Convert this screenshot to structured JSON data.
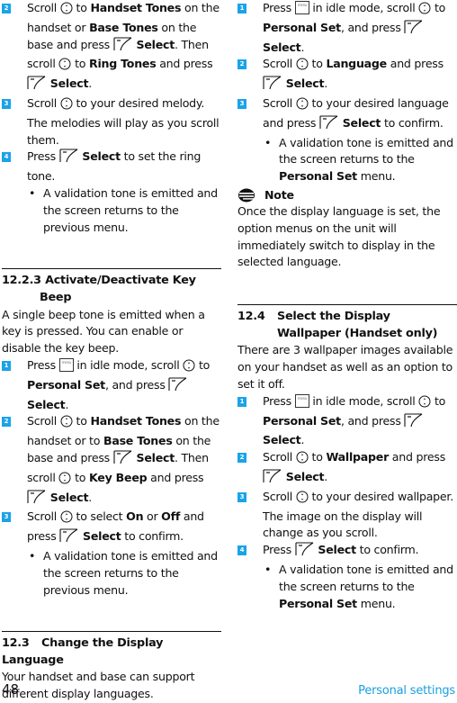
{
  "page": {
    "number": "48",
    "section_title": "Personal settings",
    "accent_color": "#1aa3e8",
    "footer_color": "#1a9fe0"
  },
  "left": {
    "top_steps": [
      {
        "n": "2",
        "parts": [
          "Scroll ",
          "{scroll}",
          " to ",
          "**Handset Tones**",
          " on the handset or ",
          "**Base Tones**",
          " on the base and press ",
          "{select}",
          " ",
          "**Select**",
          ". Then scroll ",
          "{scroll}",
          " to ",
          "**Ring Tones**",
          " and press ",
          "{select}",
          " ",
          "**Select**",
          "."
        ]
      },
      {
        "n": "3",
        "parts": [
          "Scroll ",
          "{scroll}",
          " to your desired melody. The melodies will play as you scroll them."
        ]
      },
      {
        "n": "4",
        "parts": [
          "Press ",
          "{select}",
          " ",
          "**Select**",
          " to set the ring tone."
        ]
      }
    ],
    "top_bullet": "A validation tone is emitted and the screen returns to the previous menu.",
    "key_beep": {
      "number": "12.2.3",
      "title": "Activate/Deactivate Key Beep",
      "intro": "A single beep tone is emitted when a key is pressed. You can enable or disable the key beep.",
      "steps": [
        {
          "n": "1",
          "parts": [
            "Press ",
            "{menu}",
            " in idle mode, scroll ",
            "{scroll}",
            " to ",
            "**Personal Set**",
            ", and press ",
            "{select}",
            " ",
            "**Select**",
            "."
          ]
        },
        {
          "n": "2",
          "parts": [
            "Scroll ",
            "{scroll}",
            " to ",
            "**Handset Tones**",
            " on the handset or to ",
            "**Base Tones**",
            " on the base and press ",
            "{select}",
            " ",
            "**Select**",
            ". Then scroll ",
            "{scroll}",
            " to ",
            "**Key Beep**",
            " and press ",
            "{select}",
            " ",
            "**Select**",
            "."
          ]
        },
        {
          "n": "3",
          "parts": [
            "Scroll ",
            "{scroll}",
            " to select ",
            "**On**",
            " or ",
            "**Off**",
            " and press ",
            "{select}",
            " ",
            "**Select**",
            " to confirm."
          ]
        }
      ],
      "bullet": "A validation tone is emitted and the screen returns to the previous menu."
    },
    "language": {
      "number": "12.3",
      "title": "Change the Display Language",
      "intro": "Your handset and base can support different display languages."
    }
  },
  "right": {
    "language_steps": [
      {
        "n": "1",
        "parts": [
          "Press ",
          "{menu}",
          " in idle mode, scroll ",
          "{scroll}",
          " to ",
          "**Personal Set**",
          ", and press ",
          "{select}",
          " ",
          "**Select**",
          "."
        ]
      },
      {
        "n": "2",
        "parts": [
          "Scroll ",
          "{scroll}",
          " to ",
          "**Language**",
          " and press ",
          "{select}",
          " ",
          "**Select**",
          "."
        ]
      },
      {
        "n": "3",
        "parts": [
          "Scroll ",
          "{scroll}",
          " to your desired language and press ",
          "{select}",
          " ",
          "**Select**",
          " to confirm."
        ]
      }
    ],
    "language_bullet": [
      "A validation tone is emitted and the screen returns to the ",
      "**Personal Set**",
      " menu."
    ],
    "note": {
      "label": "Note",
      "text": "Once the display language is set, the option menus on the unit will immediately switch to display in the selected language."
    },
    "wallpaper": {
      "number": "12.4",
      "title": "Select the Display Wallpaper (Handset only)",
      "intro": "There are 3 wallpaper images available on your handset as well as an option to set it off.",
      "steps": [
        {
          "n": "1",
          "parts": [
            "Press ",
            "{menu}",
            " in idle mode, scroll ",
            "{scroll}",
            " to ",
            "**Personal Set**",
            ", and press ",
            "{select}",
            " ",
            "**Select**",
            "."
          ]
        },
        {
          "n": "2",
          "parts": [
            "Scroll ",
            "{scroll}",
            " to ",
            "**Wallpaper**",
            " and press ",
            "{select}",
            " ",
            "**Select**",
            "."
          ]
        },
        {
          "n": "3",
          "parts": [
            "Scroll ",
            "{scroll}",
            " to your desired wallpaper. The image on the display will change as you scroll."
          ]
        },
        {
          "n": "4",
          "parts": [
            "Press ",
            "{select}",
            " ",
            "**Select**",
            " to confirm."
          ]
        }
      ],
      "bullet": [
        "A validation tone is emitted and the screen returns to the ",
        "**Personal Set**",
        " menu."
      ]
    }
  },
  "icons": {
    "scroll": "scroll-key-icon",
    "select": "select-softkey-icon",
    "menu": "menu-key-icon",
    "note": "note-icon"
  },
  "icon_labels": {
    "menu": "menu"
  }
}
